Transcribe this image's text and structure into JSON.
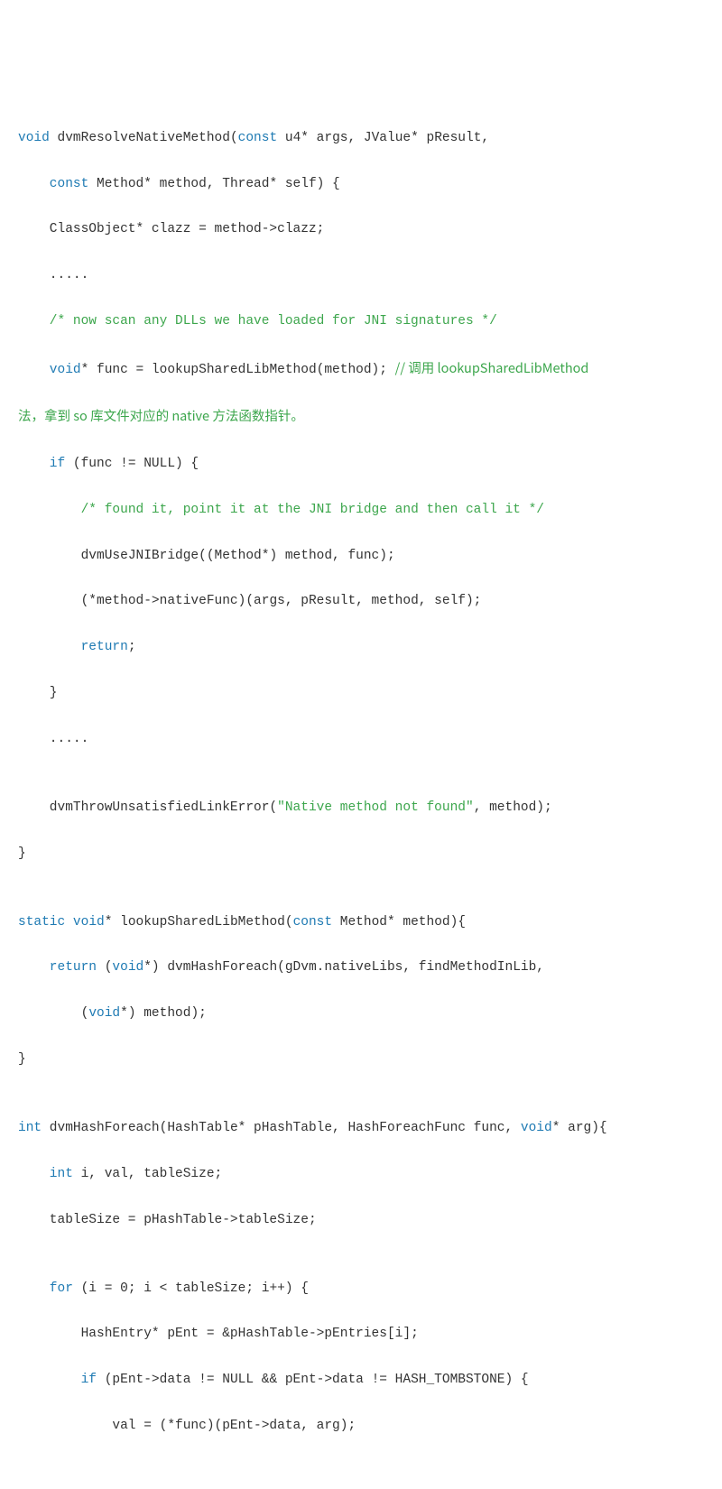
{
  "code": {
    "l1a": "void",
    "l1b": " dvmResolveNativeMethod(",
    "l1c": "const",
    "l1d": " u4* args, JValue* pResult,",
    "l2a": "const",
    "l2b": " Method* method, Thread* self) {",
    "l3": "ClassObject* clazz = method->clazz;",
    "l4": ".....",
    "l5": "/* now scan any DLLs we have loaded for JNI signatures */",
    "l6a": "void",
    "l6b": "* func = lookupSharedLibMethod(method); ",
    "l6c": "// 调用 lookupSharedLibMethod",
    "l6d": "法，拿到 so 库文件对应的 native 方法函数指针。",
    "l7a": "if",
    "l7b": " (func != NULL) {",
    "l8": "/* found it, point it at the JNI bridge and then call it */",
    "l9": "dvmUseJNIBridge((Method*) method, func);",
    "l10": "(*method->nativeFunc)(args, pResult, method, self);",
    "l11a": "return",
    "l11b": ";",
    "l12": "}",
    "l13": ".....",
    "l14": "",
    "l15a": "dvmThrowUnsatisfiedLinkError(",
    "l15b": "\"Native method not found\"",
    "l15c": ", method);",
    "l16": "}",
    "l17": "",
    "l18a": "static void",
    "l18b": "* lookupSharedLibMethod(",
    "l18c": "const",
    "l18d": " Method* method){",
    "l19a": "return",
    "l19b": " (",
    "l19c": "void",
    "l19d": "*) dvmHashForeach(gDvm.nativeLibs, findMethodInLib,",
    "l20a": "(",
    "l20b": "void",
    "l20c": "*) method);",
    "l21": "}",
    "l22": "",
    "l23a": "int",
    "l23b": " dvmHashForeach(HashTable* pHashTable, HashForeachFunc func, ",
    "l23c": "void",
    "l23d": "* arg){",
    "l24a": "int",
    "l24b": " i, val, tableSize;",
    "l25": "tableSize = pHashTable->tableSize;",
    "l26": "",
    "l27a": "for",
    "l27b": " (i = 0; i < tableSize; i++) {",
    "l28": "HashEntry* pEnt = &pHashTable->pEntries[i];",
    "l29a": "if",
    "l29b": " (pEnt->data != NULL && pEnt->data != HASH_TOMBSTONE) {",
    "l30": "val = (*func)(pEnt->data, arg);"
  }
}
